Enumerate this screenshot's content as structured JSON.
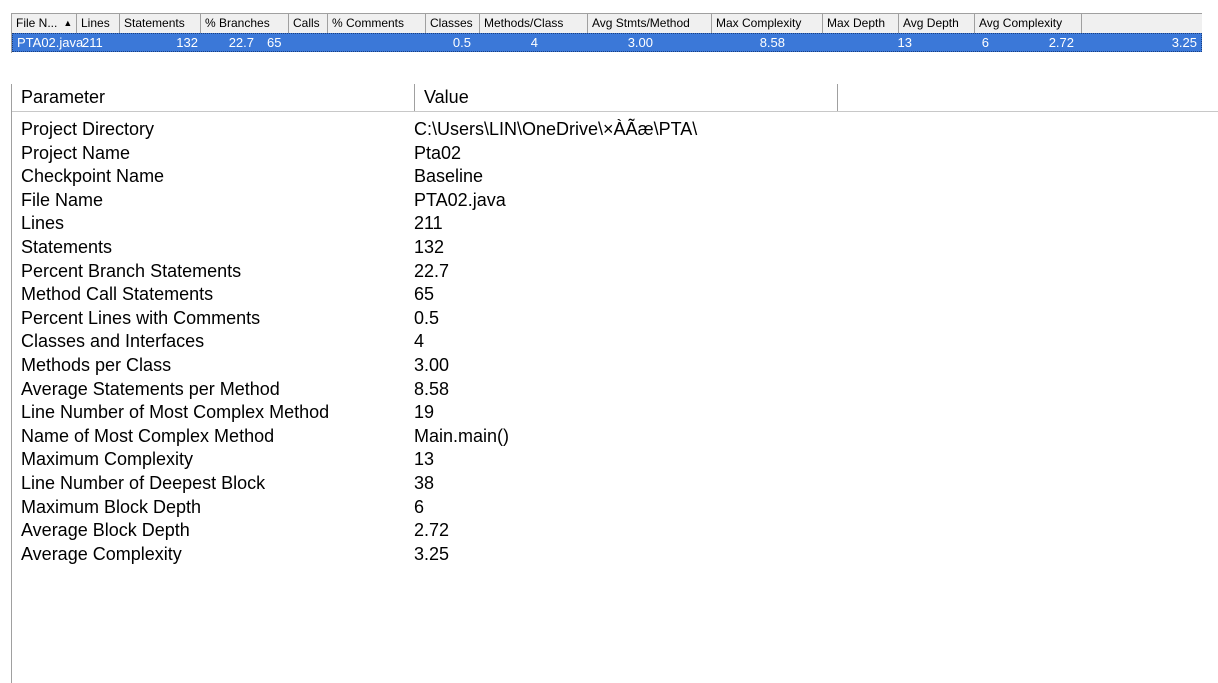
{
  "metrics_table": {
    "columns": [
      {
        "label": "File N...",
        "sort": "ascending"
      },
      {
        "label": "Lines"
      },
      {
        "label": "Statements"
      },
      {
        "label": "% Branches"
      },
      {
        "label": "Calls"
      },
      {
        "label": "% Comments"
      },
      {
        "label": "Classes"
      },
      {
        "label": "Methods/Class"
      },
      {
        "label": "Avg Stmts/Method"
      },
      {
        "label": "Max Complexity"
      },
      {
        "label": "Max Depth"
      },
      {
        "label": "Avg Depth"
      },
      {
        "label": "Avg Complexity"
      }
    ],
    "row": [
      "PTA02.java",
      "211",
      "132",
      "22.7",
      "65",
      "0.5",
      "4",
      "3.00",
      "8.58",
      "13",
      "6",
      "2.72",
      "3.25"
    ],
    "selected_row_color": "#3b78d8",
    "sort_icon": "sort-ascending-icon"
  },
  "parameter_list": {
    "headers": {
      "parameter": "Parameter",
      "value": "Value"
    },
    "rows": [
      {
        "name": "Project Directory",
        "value": "C:\\Users\\LIN\\OneDrive\\×ÀÃæ\\PTA\\"
      },
      {
        "name": "Project Name",
        "value": "Pta02"
      },
      {
        "name": "Checkpoint Name",
        "value": "Baseline"
      },
      {
        "name": "File Name",
        "value": "PTA02.java"
      },
      {
        "name": "Lines",
        "value": "211"
      },
      {
        "name": "Statements",
        "value": "132"
      },
      {
        "name": "Percent Branch Statements",
        "value": "22.7"
      },
      {
        "name": "Method Call Statements",
        "value": "65"
      },
      {
        "name": "Percent Lines with Comments",
        "value": "0.5"
      },
      {
        "name": "Classes and Interfaces",
        "value": "4"
      },
      {
        "name": "Methods per Class",
        "value": "3.00"
      },
      {
        "name": "Average Statements per Method",
        "value": "8.58"
      },
      {
        "name": "Line Number of Most Complex Method",
        "value": "19"
      },
      {
        "name": "Name of Most Complex Method",
        "value": "Main.main()"
      },
      {
        "name": "Maximum Complexity",
        "value": "13"
      },
      {
        "name": "Line Number of Deepest Block",
        "value": "38"
      },
      {
        "name": "Maximum Block Depth",
        "value": "6"
      },
      {
        "name": "Average Block Depth",
        "value": "2.72"
      },
      {
        "name": "Average Complexity",
        "value": "3.25"
      }
    ]
  }
}
